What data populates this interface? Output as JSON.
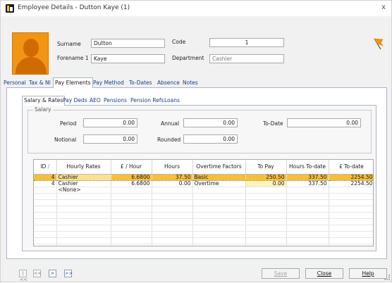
{
  "window": {
    "title": "Employee Details - Dutton Kaye (1)",
    "close_glyph": "x"
  },
  "employee": {
    "surname_label": "Surname",
    "surname": "Dutton",
    "forename_label": "Forename 1",
    "forename": "Kaye",
    "code_label": "Code",
    "code": "1",
    "department_label": "Department",
    "department": "Cashier"
  },
  "main_tabs": [
    {
      "label": "Personal"
    },
    {
      "label": "Tax & NI"
    },
    {
      "label": "Pay Elements"
    },
    {
      "label": "Pay Method"
    },
    {
      "label": "To-Dates"
    },
    {
      "label": "Absence"
    },
    {
      "label": "Notes"
    }
  ],
  "main_tabs_active": "Pay Elements",
  "sub_tabs": [
    {
      "label": "Salary & Rates"
    },
    {
      "label": "Pay Deds"
    },
    {
      "label": "AEO"
    },
    {
      "label": "Pensions"
    },
    {
      "label": "Pension Refs"
    },
    {
      "label": "Loans"
    }
  ],
  "sub_tabs_active": "Salary & Rates",
  "salary": {
    "group_label": "Salary",
    "period_label": "Period",
    "period": "0.00",
    "annual_label": "Annual",
    "annual": "0.00",
    "todate_label": "To-Date",
    "todate": "0.00",
    "notional_label": "Notional",
    "notional": "0.00",
    "rounded_label": "Rounded",
    "rounded": "0.00"
  },
  "grid": {
    "columns": [
      "ID",
      "Hourly Rates",
      "£ / Hour",
      "Hours",
      "Overtime Factors",
      "To Pay",
      "Hours To-date",
      "£ To-date"
    ],
    "sort_glyph": "/",
    "rows": [
      {
        "id": "4",
        "rate": "Cashier",
        "per_hour": "6.6800",
        "hours": "37.50",
        "factor": "Basic",
        "to_pay": "250.50",
        "hours_todate": "337.50",
        "todate": "2254.50"
      },
      {
        "id": "4",
        "rate": "Cashier",
        "per_hour": "6.6800",
        "hours": "0.00",
        "factor": "Overtime",
        "to_pay": "0.00",
        "hours_todate": "337.50",
        "todate": "2254.50"
      },
      {
        "id": "",
        "rate": "<None>",
        "per_hour": "",
        "hours": "",
        "factor": "",
        "to_pay": "",
        "hours_todate": "",
        "todate": ""
      }
    ]
  },
  "nav": {
    "first": "|<<",
    "prev": "<<",
    "next": ">",
    "last": ">>"
  },
  "buttons": {
    "save": "Save",
    "close": "Close",
    "help": "Help"
  },
  "colors": {
    "selected_row": "#f5bf3c",
    "flag": "#f29513"
  }
}
